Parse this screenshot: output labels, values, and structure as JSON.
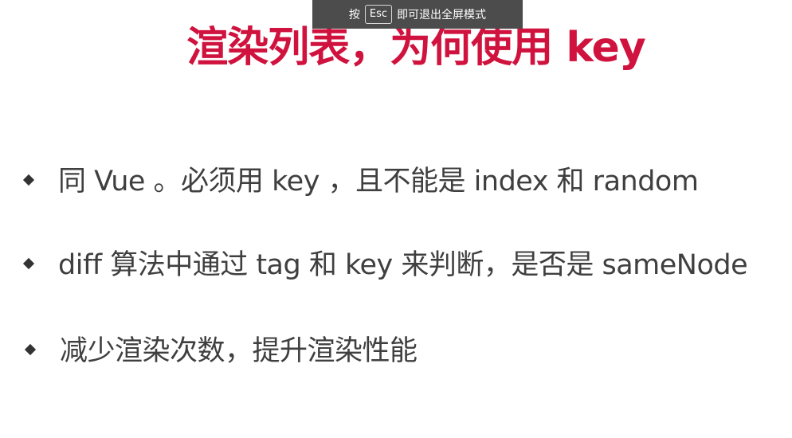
{
  "fullscreen_hint": {
    "prefix": "按",
    "key": "Esc",
    "suffix": "即可退出全屏模式"
  },
  "slide": {
    "title": "渲染列表，为何使用 key",
    "bullets": [
      "同 Vue 。必须用 key ，且不能是 index 和 random",
      "diff 算法中通过 tag 和 key 来判断，是否是 sameNode",
      "减少渲染次数，提升渲染性能"
    ]
  },
  "colors": {
    "title": "#d0123e",
    "text": "#3f3f3f",
    "bullet_marker": "#333333",
    "banner_bg": "#4c4c4c"
  }
}
